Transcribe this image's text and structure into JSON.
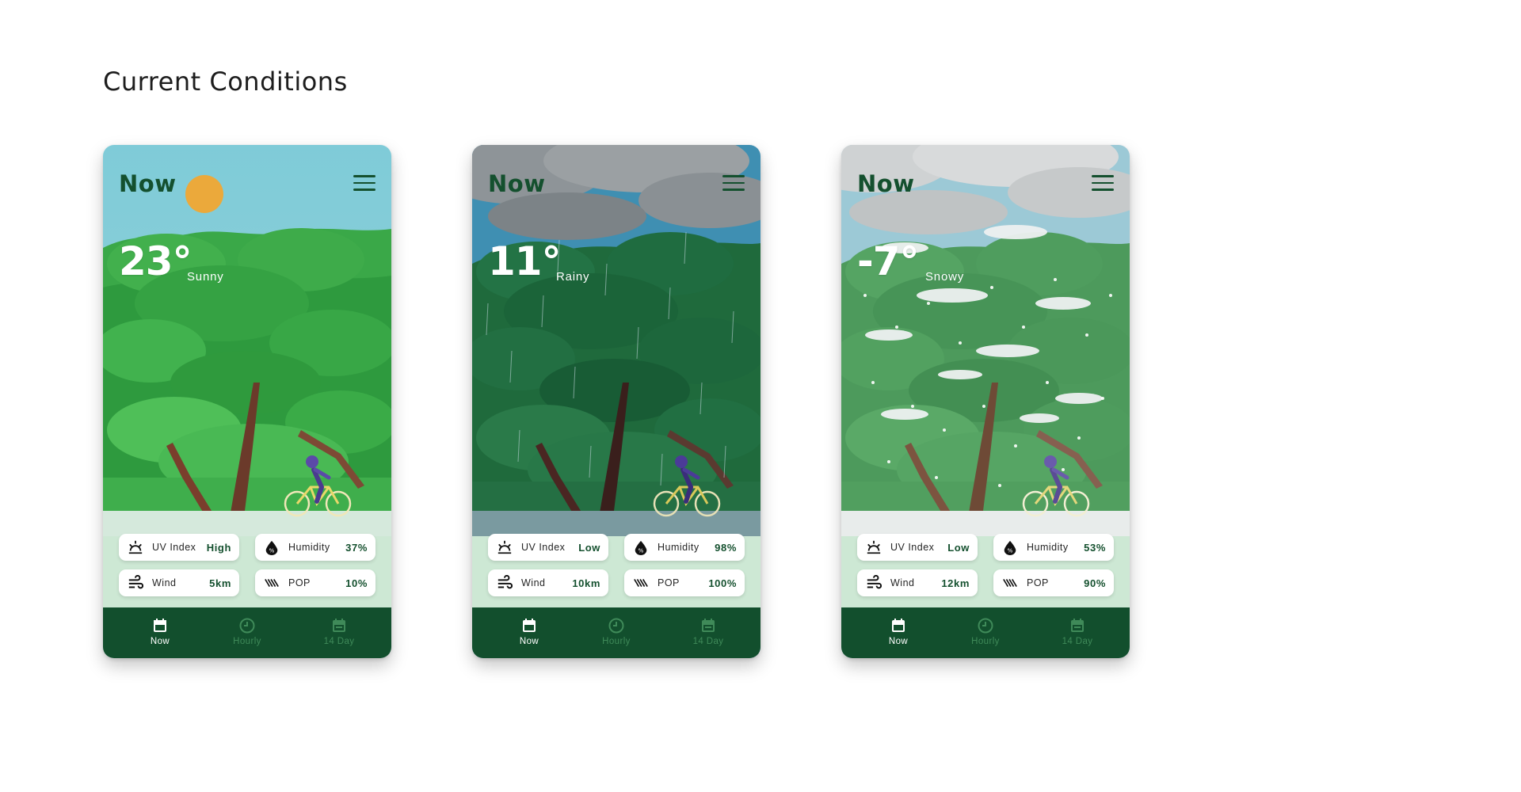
{
  "page": {
    "title": "Current Conditions"
  },
  "colors": {
    "brand_dark_green": "#124f2d",
    "title_green": "#14502e",
    "stats_band": "#cde8d4",
    "nav_inactive": "#3f8a59"
  },
  "phones": [
    {
      "variant": "sunny",
      "header": "Now",
      "temperature": "23°",
      "condition": "Sunny",
      "stats": {
        "uv": {
          "icon": "uv-index-icon",
          "label": "UV Index",
          "value": "High"
        },
        "humidity": {
          "icon": "humidity-drop-icon",
          "label": "Humidity",
          "value": "37%"
        },
        "wind": {
          "icon": "wind-icon",
          "label": "Wind",
          "value": "5km"
        },
        "pop": {
          "icon": "rain-streaks-icon",
          "label": "POP",
          "value": "10%"
        }
      },
      "nav": [
        {
          "icon": "calendar-icon",
          "label": "Now",
          "active": true
        },
        {
          "icon": "clock-icon",
          "label": "Hourly",
          "active": false
        },
        {
          "icon": "calendar-icon",
          "label": "14 Day",
          "active": false
        }
      ]
    },
    {
      "variant": "rainy",
      "header": "Now",
      "temperature": "11°",
      "condition": "Rainy",
      "stats": {
        "uv": {
          "icon": "uv-index-icon",
          "label": "UV Index",
          "value": "Low"
        },
        "humidity": {
          "icon": "humidity-drop-icon",
          "label": "Humidity",
          "value": "98%"
        },
        "wind": {
          "icon": "wind-icon",
          "label": "Wind",
          "value": "10km"
        },
        "pop": {
          "icon": "rain-streaks-icon",
          "label": "POP",
          "value": "100%"
        }
      },
      "nav": [
        {
          "icon": "calendar-icon",
          "label": "Now",
          "active": true
        },
        {
          "icon": "clock-icon",
          "label": "Hourly",
          "active": false
        },
        {
          "icon": "calendar-icon",
          "label": "14 Day",
          "active": false
        }
      ]
    },
    {
      "variant": "snowy",
      "header": "Now",
      "temperature": "-7°",
      "condition": "Snowy",
      "stats": {
        "uv": {
          "icon": "uv-index-icon",
          "label": "UV Index",
          "value": "Low"
        },
        "humidity": {
          "icon": "humidity-drop-icon",
          "label": "Humidity",
          "value": "53%"
        },
        "wind": {
          "icon": "wind-icon",
          "label": "Wind",
          "value": "12km"
        },
        "pop": {
          "icon": "rain-streaks-icon",
          "label": "POP",
          "value": "90%"
        }
      },
      "nav": [
        {
          "icon": "calendar-icon",
          "label": "Now",
          "active": true
        },
        {
          "icon": "clock-icon",
          "label": "Hourly",
          "active": false
        },
        {
          "icon": "calendar-icon",
          "label": "14 Day",
          "active": false
        }
      ]
    }
  ]
}
